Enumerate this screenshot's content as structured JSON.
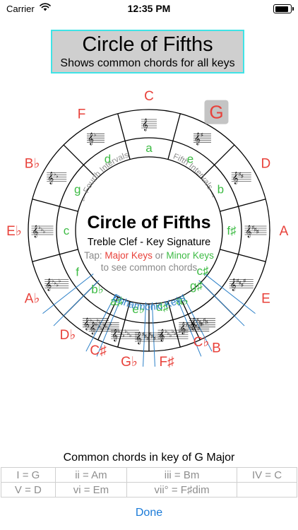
{
  "status": {
    "carrier": "Carrier",
    "time": "12:35 PM",
    "battery_level": 0.9
  },
  "header": {
    "title": "Circle of Fifths",
    "subtitle": "Shows common chords for all keys"
  },
  "wheel": {
    "colors": {
      "major": "#e8413a",
      "minor": "#3dbb44",
      "enharmonic": "#2a7fc8",
      "selected_bg": "#c4c4c4",
      "interval": "#8a8a8a"
    },
    "major_keys": [
      {
        "name": "C",
        "note": ""
      },
      {
        "name": "G",
        "note": ""
      },
      {
        "name": "D",
        "note": ""
      },
      {
        "name": "A",
        "note": ""
      },
      {
        "name": "E",
        "note": ""
      },
      {
        "name": "B",
        "note": ""
      },
      {
        "name": "C",
        "note": "b"
      },
      {
        "name": "F",
        "note": "#"
      },
      {
        "name": "G",
        "note": "b"
      },
      {
        "name": "C",
        "note": "#"
      },
      {
        "name": "D",
        "note": "b"
      },
      {
        "name": "A",
        "note": "b"
      },
      {
        "name": "E",
        "note": "b"
      },
      {
        "name": "B",
        "note": "b"
      },
      {
        "name": "F",
        "note": ""
      }
    ],
    "minor_keys": [
      {
        "name": "a",
        "note": ""
      },
      {
        "name": "e",
        "note": ""
      },
      {
        "name": "b",
        "note": ""
      },
      {
        "name": "f",
        "note": "#"
      },
      {
        "name": "c",
        "note": "#"
      },
      {
        "name": "g",
        "note": "#"
      },
      {
        "name": "a",
        "note": "b"
      },
      {
        "name": "d",
        "note": "#"
      },
      {
        "name": "e",
        "note": "b"
      },
      {
        "name": "a",
        "note": "#"
      },
      {
        "name": "b",
        "note": "b"
      },
      {
        "name": "f",
        "note": ""
      },
      {
        "name": "c",
        "note": ""
      },
      {
        "name": "g",
        "note": ""
      },
      {
        "name": "d",
        "note": ""
      }
    ],
    "selected_key": "G",
    "center_title": "Circle of Fifths",
    "center_subtitle": "Treble Clef - Key Signature",
    "tap_prefix": "Tap:",
    "tap_major": "Major Keys",
    "tap_or": "or",
    "tap_minor": "Minor Keys",
    "tap_line2": "to see common chords",
    "fourth_label": "Fourth Intervals",
    "fifth_label": "Fifth Intervals",
    "enharmonic_label": "Enharmonic Keys"
  },
  "chords": {
    "title": "Common chords in key of G Major",
    "row1": [
      "I = G",
      "ii = Am",
      "iii = Bm",
      "IV = C"
    ],
    "row2": [
      "V = D",
      "vi = Em",
      "vii° = F♯dim"
    ]
  },
  "done_label": "Done"
}
